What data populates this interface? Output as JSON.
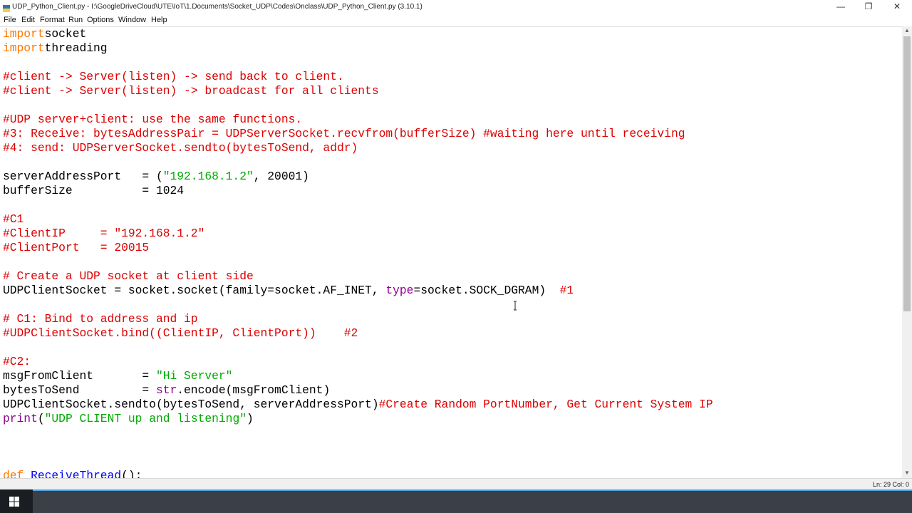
{
  "window": {
    "title": "UDP_Python_Client.py - I:\\GoogleDriveCloud\\UTE\\IoT\\1.Documents\\Socket_UDP\\Codes\\Onclass\\UDP_Python_Client.py (3.10.1)",
    "minimize": "—",
    "restore": "❐",
    "close": "✕"
  },
  "menu": [
    "File",
    "Edit",
    "Format",
    "Run",
    "Options",
    "Window",
    "Help"
  ],
  "code": [
    [
      [
        "kw",
        "import"
      ],
      [
        "",
        "socket"
      ]
    ],
    [
      [
        "kw",
        "import"
      ],
      [
        "",
        "threading"
      ]
    ],
    [],
    [
      [
        "cm",
        "#client -> Server(listen) -> send back to client."
      ]
    ],
    [
      [
        "cm",
        "#client -> Server(listen) -> broadcast for all clients"
      ]
    ],
    [],
    [
      [
        "cm",
        "#UDP server+client: use the same functions."
      ]
    ],
    [
      [
        "cm",
        "#3: Receive: bytesAddressPair = UDPServerSocket.recvfrom(bufferSize) #waiting here until receiving"
      ]
    ],
    [
      [
        "cm",
        "#4: send: UDPServerSocket.sendto(bytesToSend, addr)"
      ]
    ],
    [],
    [
      [
        "",
        "serverAddressPort   = ("
      ],
      [
        "st",
        "\"192.168.1.2\""
      ],
      [
        "",
        ", 20001)"
      ]
    ],
    [
      [
        "",
        "bufferSize          = 1024"
      ]
    ],
    [],
    [
      [
        "cm",
        "#C1"
      ]
    ],
    [
      [
        "cm",
        "#ClientIP     = \"192.168.1.2\""
      ]
    ],
    [
      [
        "cm",
        "#ClientPort   = 20015"
      ]
    ],
    [],
    [
      [
        "cm",
        "# Create a UDP socket at client side"
      ]
    ],
    [
      [
        "",
        "UDPClientSocket = socket.socket(family=socket.AF_INET, "
      ],
      [
        "bi",
        "type"
      ],
      [
        "",
        "=socket.SOCK_DGRAM)  "
      ],
      [
        "cm",
        "#1"
      ]
    ],
    [],
    [
      [
        "cm",
        "# C1: Bind to address and ip"
      ]
    ],
    [
      [
        "cm",
        "#UDPClientSocket.bind((ClientIP, ClientPort))    #2"
      ]
    ],
    [],
    [
      [
        "cm",
        "#C2:"
      ]
    ],
    [
      [
        "",
        "msgFromClient       = "
      ],
      [
        "st",
        "\"Hi Server\""
      ]
    ],
    [
      [
        "",
        "bytesToSend         = "
      ],
      [
        "bi",
        "str"
      ],
      [
        "",
        ".encode(msgFromClient)"
      ]
    ],
    [
      [
        "",
        "UDPClientSocket.sendto(bytesToSend, serverAddressPort)"
      ],
      [
        "cm",
        "#Create Random PortNumber, Get Current System IP"
      ]
    ],
    [
      [
        "bi",
        "print"
      ],
      [
        "",
        "("
      ],
      [
        "st",
        "\"UDP CLIENT up and listening\""
      ],
      [
        "",
        ")"
      ]
    ],
    [],
    [],
    [],
    [
      [
        "kw",
        "def"
      ],
      [
        "",
        ""
      ],
      [
        "df",
        " ReceiveThread"
      ],
      [
        "",
        "():"
      ]
    ]
  ],
  "status": {
    "line_col": "Ln: 29   Col: 0"
  },
  "icons": {
    "start": "windows-logo-icon",
    "up_arrow": "▲",
    "down_arrow": "▼"
  }
}
